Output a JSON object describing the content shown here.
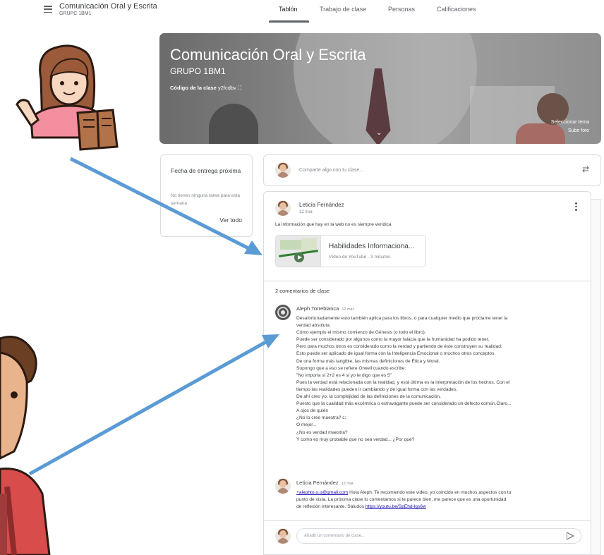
{
  "header": {
    "course_name": "Comunicación Oral y Escrita",
    "course_group": "GRUPC 1BM1",
    "tabs": [
      {
        "label": "Tablón",
        "active": true
      },
      {
        "label": "Trabajo de clase",
        "active": false
      },
      {
        "label": "Personas",
        "active": false
      },
      {
        "label": "Calificaciones",
        "active": false
      }
    ]
  },
  "banner": {
    "title": "Comunicación Oral y Escrita",
    "group": "GRUPO 1BM1",
    "code_label": "Código de la clase",
    "code_value": "y2fcdbv",
    "select_theme": "Seleccionar tema",
    "upload_photo": "Subir foto"
  },
  "upcoming": {
    "title": "Fecha de entrega próxima",
    "empty_text": "No tienes ninguna tarea para esta semana",
    "view_all": "Ver todo"
  },
  "share": {
    "placeholder": "Comparte algo con tu clase..."
  },
  "post": {
    "author": "Leticia Fernández",
    "date": "12 mar.",
    "text": "La información que hay en la web no es siempre verídica",
    "attachment": {
      "title": "Habilidades Informaciona...",
      "subtitle": "Vídeo de YouTube · 3 minutos"
    },
    "comments_count": "2 comentarios de clase",
    "comments": [
      {
        "author": "Aleph Torreblanca",
        "date": "12 mar.",
        "lines": [
          "Desafortunadamente esto también aplica para los libros, o para cualquier medio que proclame tener la",
          "verdad absoluta.",
          "Cómo ejemplo el mismo comienzo de Génesis (o todo el libro).",
          "Puede ser considerado por algunos como la mayor falacia que la humanidad ha podido tener.",
          "Pero para muchos otros es considerado como la verdad y partiendo de éste construyen su realidad.",
          "Esto puede ser aplicado de igual forma con la Inteligencia Emocional o muchos otros conceptos.",
          "De una forma más tangible, las mismas definiciones de Ética y Moral.",
          "Supongo que a eso se refiere Orwell cuando escribe:",
          "\"No importa si 2+2 es 4 si yo te digo que es 5\"",
          "Pues la verdad está relacionada con la realidad, y está última es la interpretación de los hechos. Con el",
          "tiempo las realidades pueden ir cambiando y de igual forma con las verdades.",
          "De ahí creo yo, la complejidad de las definiciones de la comunicación.",
          "Puesto que la cualidad más excéntrica o extravagante puede ser considerado un defecto común.Claro...",
          "A ojos de quién",
          "¿No lo cree maestra? c:",
          "O mejor...",
          "¿No es verdad maestra?",
          "Y como es muy probable que no sea verdad... ¿Por qué?"
        ]
      },
      {
        "author": "Leticia Fernández",
        "date": "12 mar.",
        "mention": "+alephto.o.o@gmail.com",
        "line1_rest": " Hola Aleph. Te recomiendo este video, yo coincido en muchos aspectos con tu",
        "line2": "punto de vista. La próxima clase lo comentamos si te parece bien, me parece que es una oportunidad",
        "line3_text": "de reflexión interesante. Saludos ",
        "link": "https://youtu.be/SpEhd-lgs6w"
      }
    ],
    "reply_placeholder": "Añadir un comentario de clase..."
  },
  "icons": {
    "menu": "hamburger-menu-icon",
    "fullscreen": "fullscreen-icon",
    "expand": "chevron-down-icon",
    "repost": "repost-arrows-icon",
    "more": "more-vert-icon",
    "play": "play-icon",
    "send": "send-icon"
  },
  "colors": {
    "arrow": "#5b9bd5",
    "link": "#1a0dab",
    "border": "#dadce0"
  }
}
